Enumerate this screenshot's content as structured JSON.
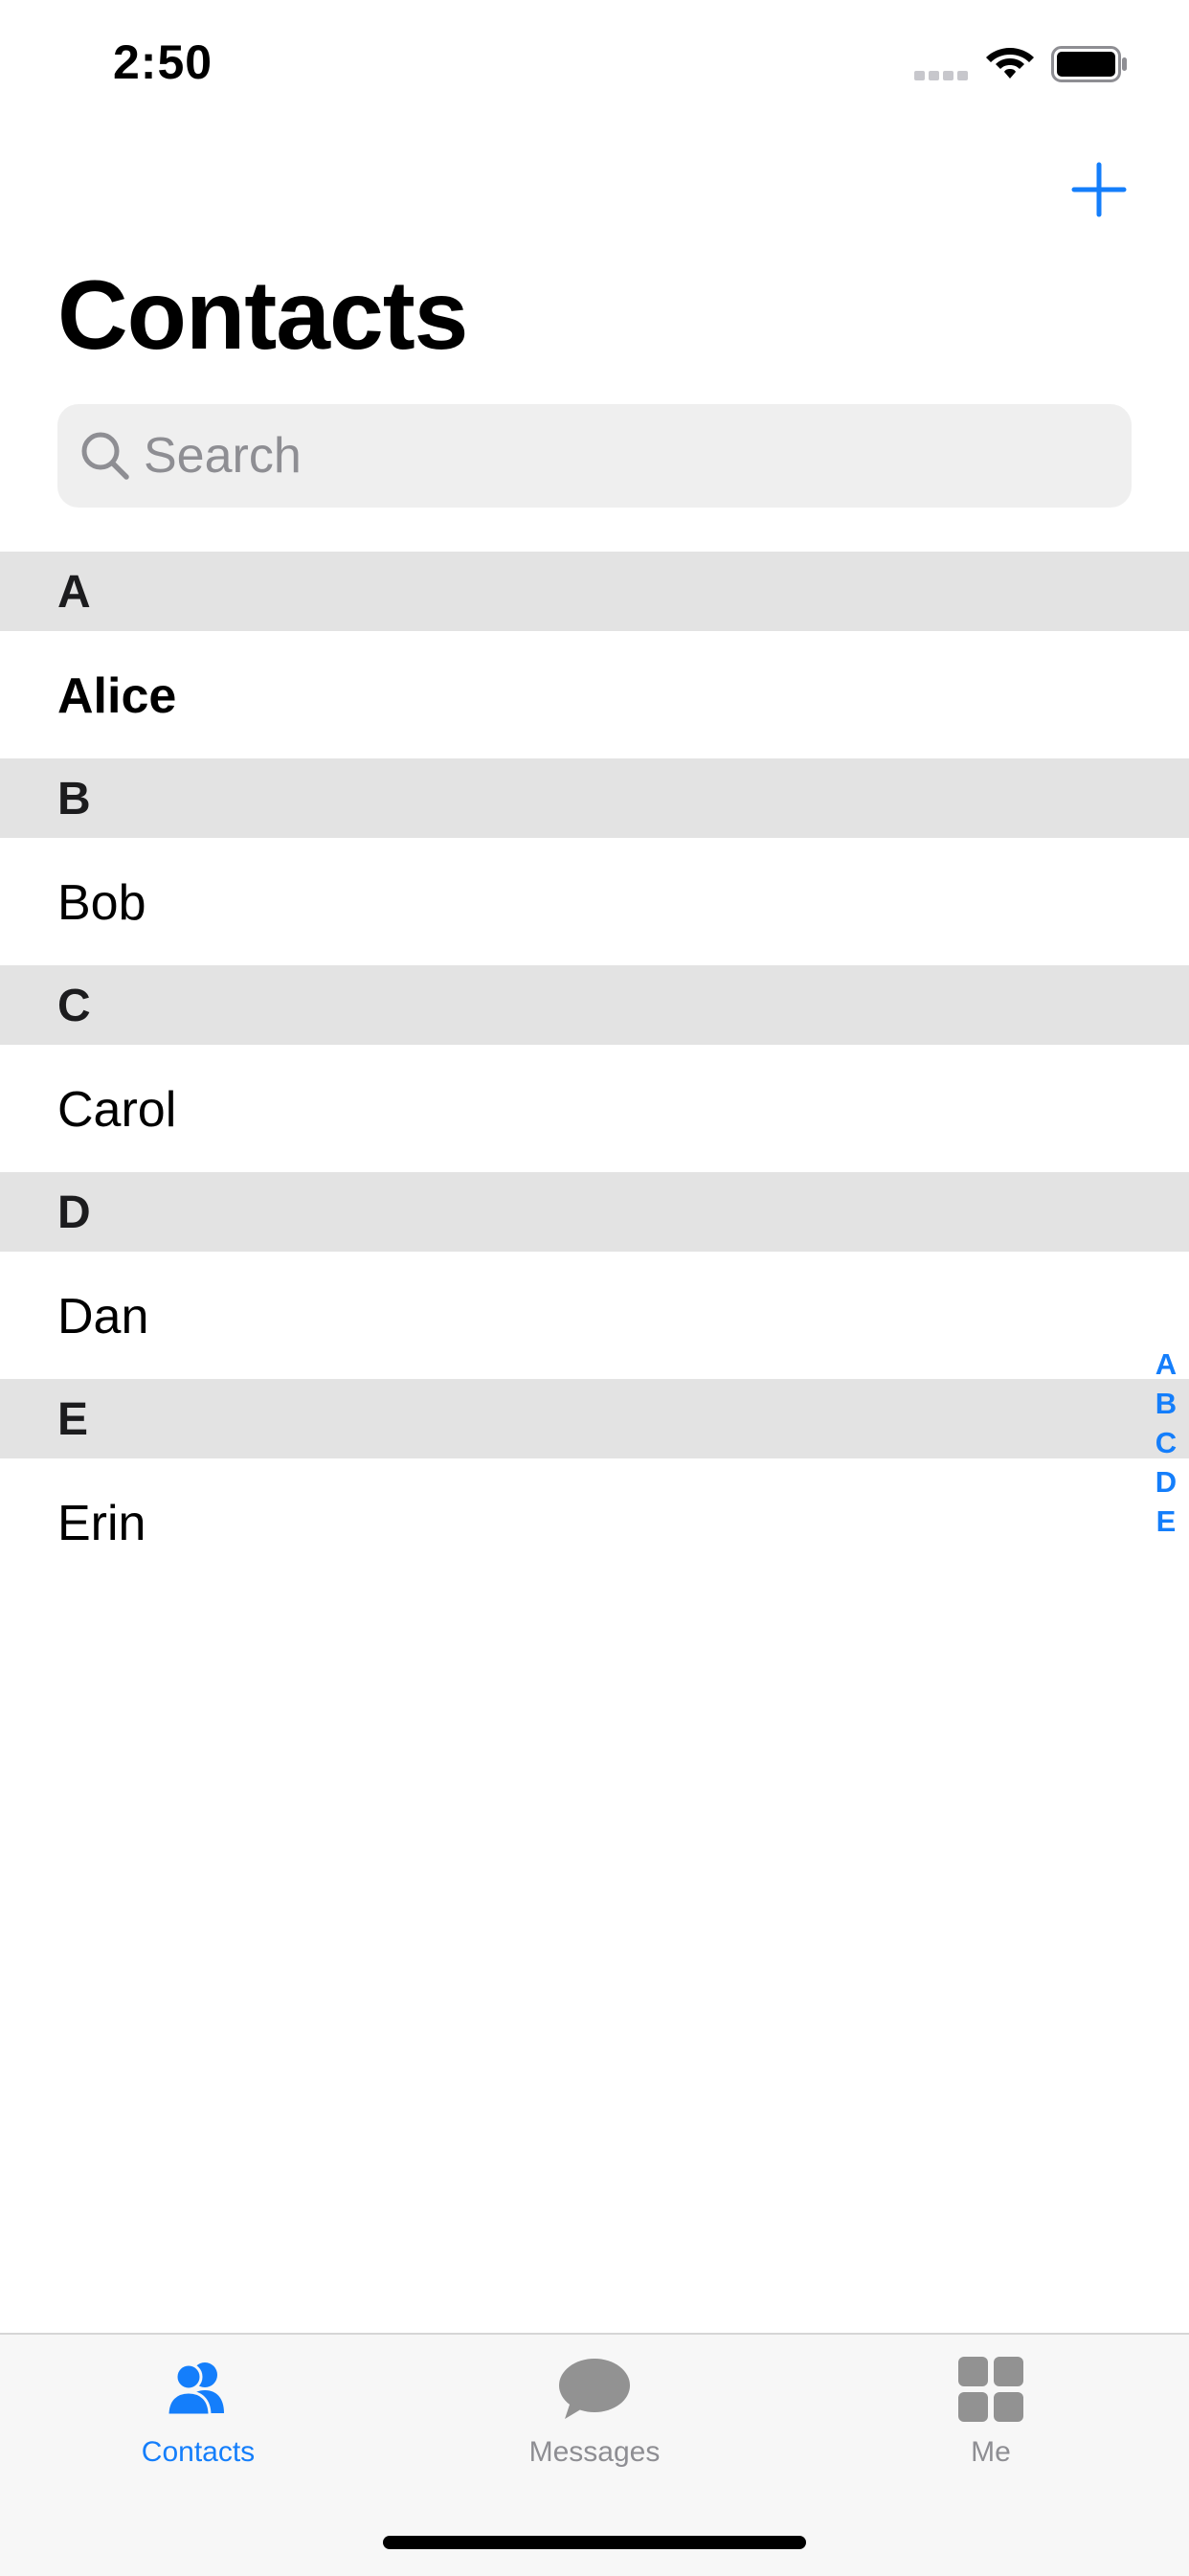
{
  "status_bar": {
    "time": "2:50"
  },
  "header": {
    "title": "Contacts",
    "add_icon": "plus-icon"
  },
  "search": {
    "placeholder": "Search",
    "value": ""
  },
  "sections": [
    {
      "letter": "A",
      "contacts": [
        "Alice"
      ]
    },
    {
      "letter": "B",
      "contacts": [
        "Bob"
      ]
    },
    {
      "letter": "C",
      "contacts": [
        "Carol"
      ]
    },
    {
      "letter": "D",
      "contacts": [
        "Dan"
      ]
    },
    {
      "letter": "E",
      "contacts": [
        "Erin"
      ]
    }
  ],
  "index": [
    "A",
    "B",
    "C",
    "D",
    "E"
  ],
  "tabs": [
    {
      "label": "Contacts",
      "icon": "contacts-icon",
      "active": true
    },
    {
      "label": "Messages",
      "icon": "messages-icon",
      "active": false
    },
    {
      "label": "Me",
      "icon": "grid-icon",
      "active": false
    }
  ],
  "colors": {
    "accent": "#147efb",
    "section_header_bg": "#e3e3e3",
    "search_bg": "#efefef",
    "inactive_tab": "#8e8e93"
  }
}
